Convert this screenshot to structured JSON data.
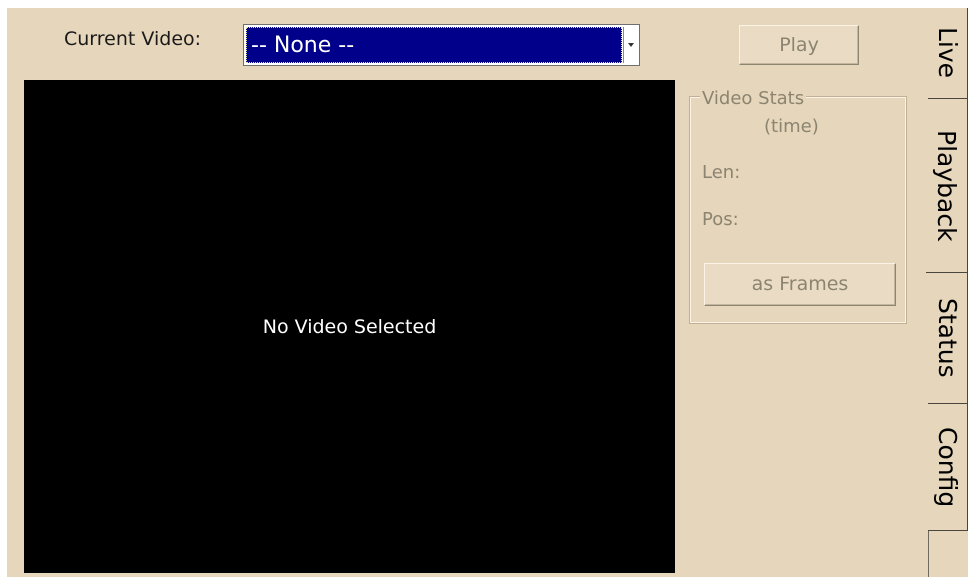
{
  "playback": {
    "current_video_label": "Current Video:",
    "selected_video": "-- None --",
    "play_label": "Play",
    "video_message": "No Video Selected"
  },
  "video_stats": {
    "title": "Video Stats",
    "subtitle": "(time)",
    "len_label": "Len:",
    "pos_label": "Pos:",
    "toggle_label": "as Frames"
  },
  "tabs": [
    {
      "label": "Live",
      "active": false
    },
    {
      "label": "Playback",
      "active": true
    },
    {
      "label": "Status",
      "active": false
    },
    {
      "label": "Config",
      "active": false
    }
  ],
  "colors": {
    "panel": "#e6d6bb",
    "selection": "#00008a",
    "video_bg": "#000000",
    "disabled_text": "#8b8470"
  }
}
